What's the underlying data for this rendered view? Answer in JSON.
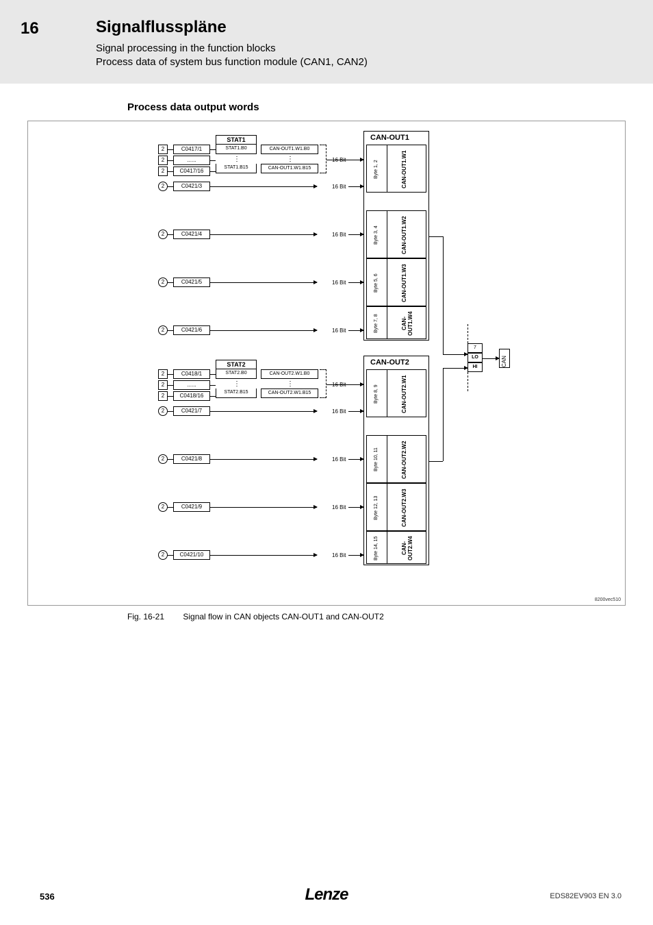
{
  "chapter": {
    "num": "16",
    "title": "Signalflusspläne"
  },
  "subtitle1": "Signal processing in the function blocks",
  "subtitle2": "Process data of system bus function module (CAN1, CAN2)",
  "section_heading": "Process data output words",
  "figure": {
    "num": "Fig. 16-21",
    "caption": "Signal flow in CAN objects CAN-OUT1 and CAN-OUT2"
  },
  "footer": {
    "page": "536",
    "brand": "Lenze",
    "doc_id": "EDS82EV903 EN 3.0"
  },
  "diagram_code": "8200vec510",
  "can_out": [
    {
      "title": "CAN-OUT1",
      "stat": {
        "head": "STAT1",
        "b0": "STAT1.B0",
        "b15": "STAT1.B15",
        "w_b0": "CAN-OUT1.W1.B0",
        "w_b15": "CAN-OUT1.W1.B15"
      },
      "dig_params": [
        "C0417/1",
        "......",
        "C0417/16"
      ],
      "words": [
        {
          "param": "C0421/3",
          "bytes": "Byte 1, 2",
          "name": "CAN-OUT1.W1"
        },
        {
          "param": "C0421/4",
          "bytes": "Byte 3, 4",
          "name": "CAN-OUT1.W2"
        },
        {
          "param": "C0421/5",
          "bytes": "Byte 5, 6",
          "name": "CAN-OUT1.W3"
        },
        {
          "param": "C0421/6",
          "bytes": "Byte 7, 8",
          "name": "CAN-OUT1.W4"
        }
      ]
    },
    {
      "title": "CAN-OUT2",
      "stat": {
        "head": "STAT2",
        "b0": "STAT2.B0",
        "b15": "STAT2.B15",
        "w_b0": "CAN-OUT2.W1.B0",
        "w_b15": "CAN-OUT2.W1.B15"
      },
      "dig_params": [
        "C0418/1",
        "......",
        "C0418/16"
      ],
      "words": [
        {
          "param": "C0421/7",
          "bytes": "Byte 8, 9",
          "name": "CAN-OUT2.W1"
        },
        {
          "param": "C0421/8",
          "bytes": "Byte 10, 11",
          "name": "CAN-OUT2.W2"
        },
        {
          "param": "C0421/9",
          "bytes": "Byte 12, 13",
          "name": "CAN-OUT2.W3"
        },
        {
          "param": "C0421/10",
          "bytes": "Byte 14, 15",
          "name": "CAN-OUT2.W4"
        }
      ]
    }
  ],
  "label_16bit": "16 Bit",
  "label_sel_d": "2",
  "label_sel_a": "2",
  "prio": {
    "num": "7",
    "lo": "LO",
    "hi": "HI"
  },
  "can_label": "CAN"
}
